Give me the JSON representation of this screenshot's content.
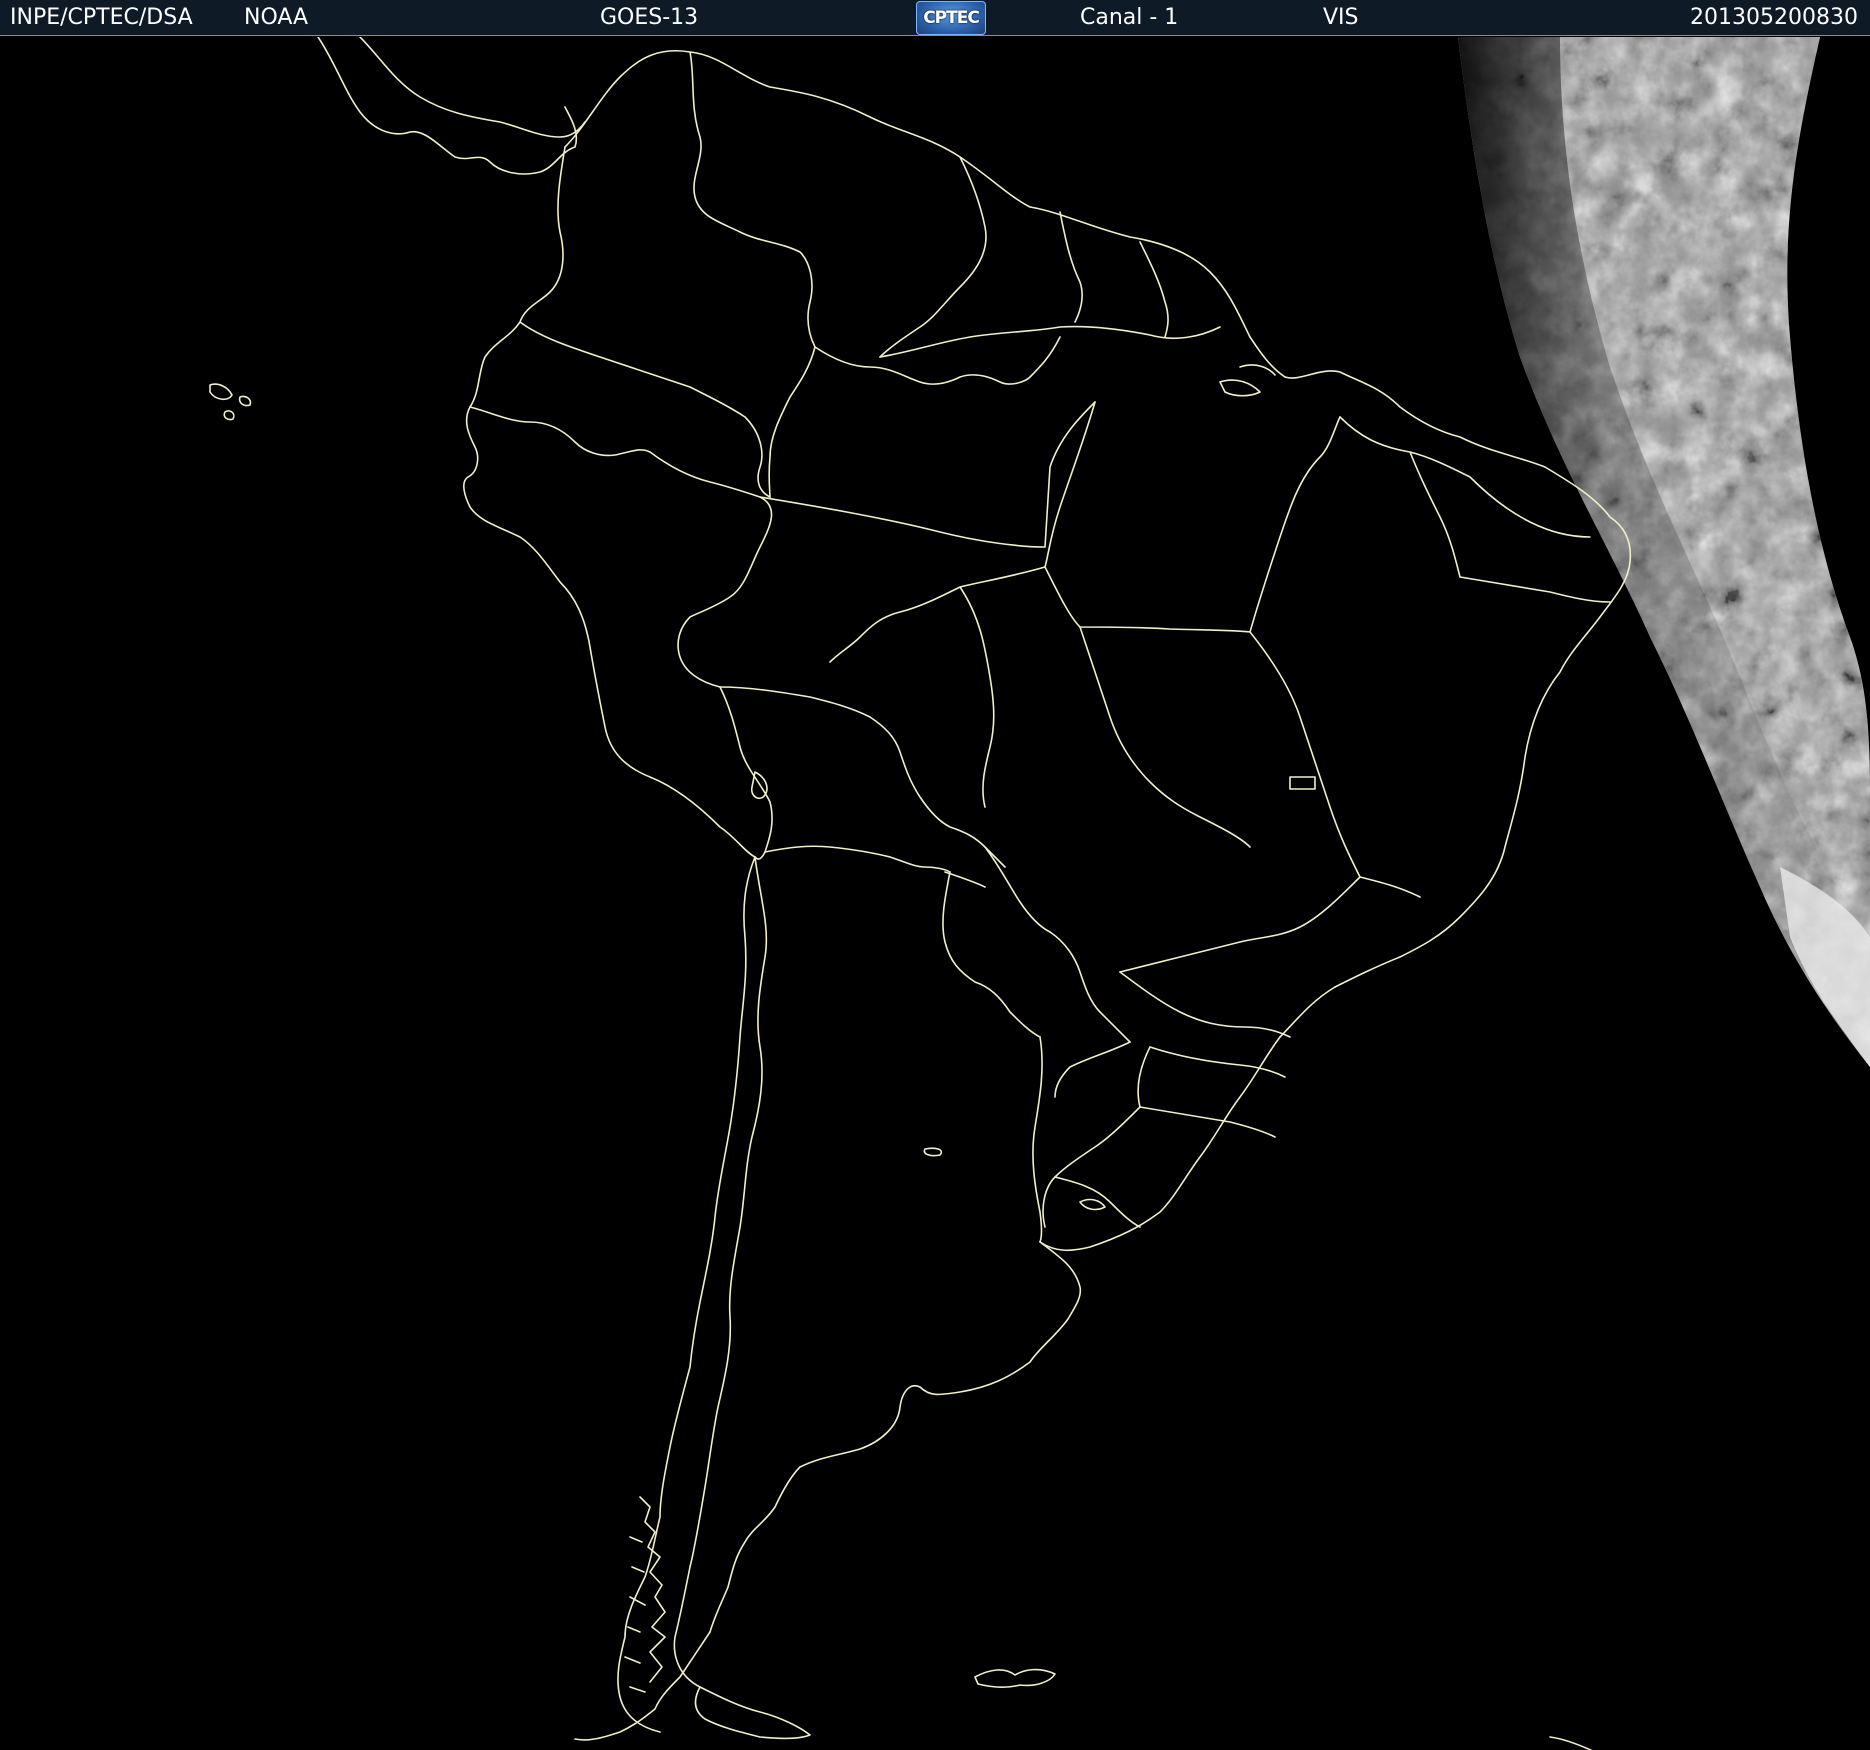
{
  "header": {
    "source": "INPE/CPTEC/DSA",
    "agency": "NOAA",
    "satellite": "GOES-13",
    "logo_text": "CPTEC",
    "channel": "Canal - 1",
    "band": "VIS",
    "timestamp": "201305200830"
  },
  "colors": {
    "header_bg": "#0e1a25",
    "boundary_line": "#f1efc8",
    "cloud_imagery": "#9a9a9a",
    "night_background": "#000000"
  }
}
